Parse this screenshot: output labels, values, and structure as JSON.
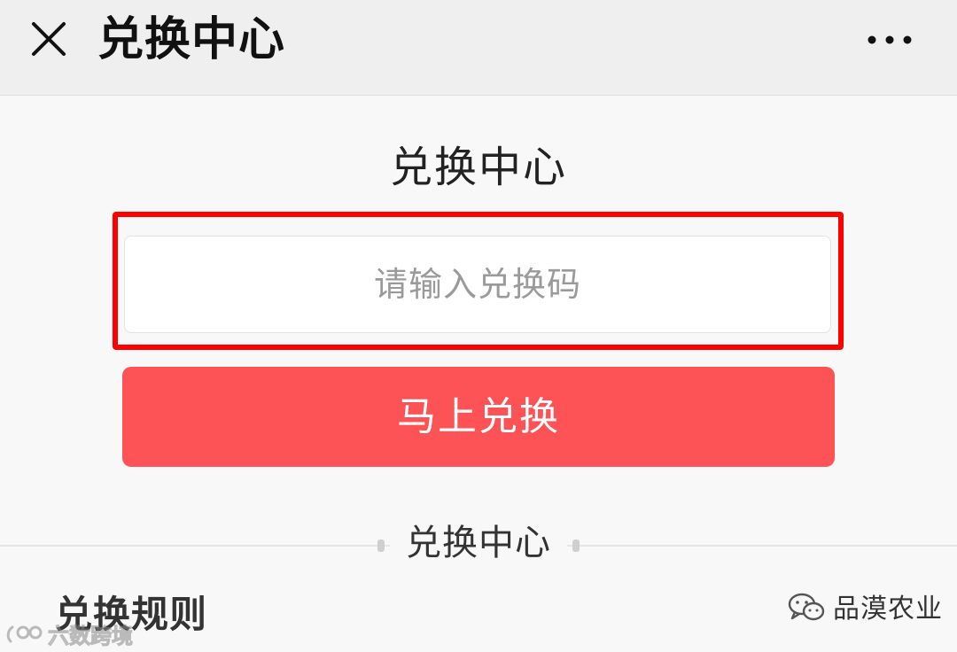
{
  "header": {
    "close_icon": "close-icon",
    "title": "兑换中心",
    "more_icon": "more-dots-icon"
  },
  "main": {
    "heading": "兑换中心",
    "code_input": {
      "value": "",
      "placeholder": "请输入兑换码"
    },
    "redeem_button_label": "马上兑换",
    "divider_label": "兑换中心",
    "rules_title": "兑换规则"
  },
  "watermarks": {
    "left_text": "六数跨境",
    "right_text": "品漠农业"
  },
  "colors": {
    "button_bg": "#fd5356",
    "highlight_border": "#ff0000",
    "topbar_bg": "#efefef",
    "page_bg": "#f8f8f8"
  }
}
